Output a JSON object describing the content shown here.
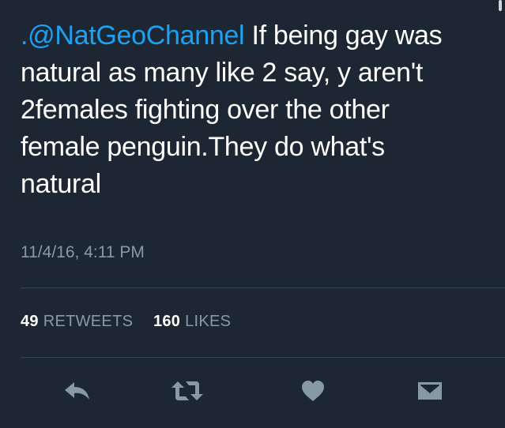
{
  "tweet": {
    "mention": ".@NatGeoChannel",
    "text": " If being gay was natural as many like 2 say, y aren't 2females fighting over the other female penguin.They do what's natural",
    "timestamp": "11/4/16, 4:11 PM"
  },
  "stats": {
    "retweets_count": "49",
    "retweets_label": "RETWEETS",
    "likes_count": "160",
    "likes_label": "LIKES"
  },
  "actions": [
    "reply-icon",
    "retweet-icon",
    "like-icon",
    "direct-message-icon"
  ],
  "colors": {
    "background": "#1c2733",
    "text": "#ffffff",
    "link": "#1da1f2",
    "muted": "#8899a6",
    "divider": "#38444d"
  }
}
